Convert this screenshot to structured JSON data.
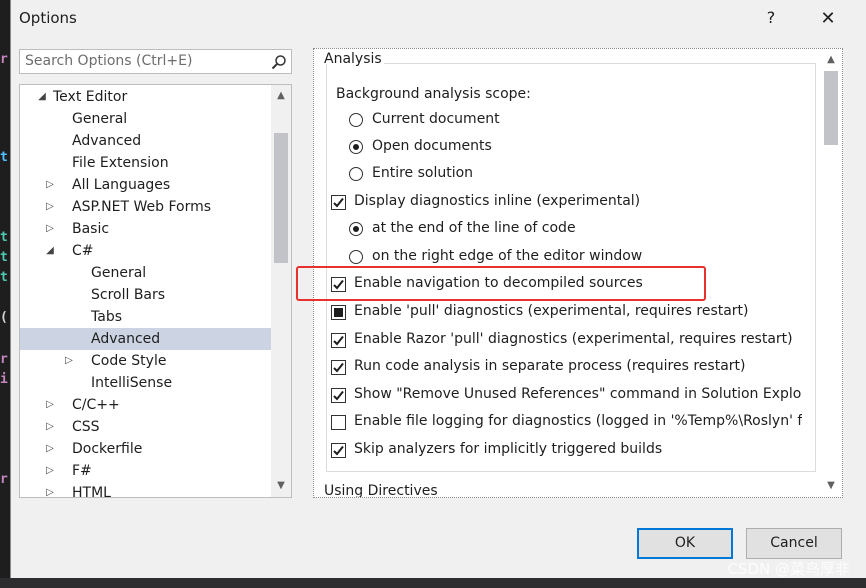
{
  "window": {
    "title": "Options",
    "help_label": "?",
    "close_label": "✕"
  },
  "search": {
    "placeholder": "Search Options (Ctrl+E)"
  },
  "tree": {
    "items": [
      {
        "label": "Text Editor",
        "arrow": "◢"
      },
      {
        "label": "General",
        "arrow": ""
      },
      {
        "label": "Advanced",
        "arrow": ""
      },
      {
        "label": "File Extension",
        "arrow": ""
      },
      {
        "label": "All Languages",
        "arrow": "▷"
      },
      {
        "label": "ASP.NET Web Forms",
        "arrow": "▷"
      },
      {
        "label": "Basic",
        "arrow": "▷"
      },
      {
        "label": "C#",
        "arrow": "◢"
      },
      {
        "label": "General",
        "arrow": ""
      },
      {
        "label": "Scroll Bars",
        "arrow": ""
      },
      {
        "label": "Tabs",
        "arrow": ""
      },
      {
        "label": "Advanced",
        "arrow": ""
      },
      {
        "label": "Code Style",
        "arrow": "▷"
      },
      {
        "label": "IntelliSense",
        "arrow": ""
      },
      {
        "label": "C/C++",
        "arrow": "▷"
      },
      {
        "label": "CSS",
        "arrow": "▷"
      },
      {
        "label": "Dockerfile",
        "arrow": "▷"
      },
      {
        "label": "F#",
        "arrow": "▷"
      },
      {
        "label": "HTML",
        "arrow": "▷"
      }
    ],
    "selected_label": "Advanced"
  },
  "analysis": {
    "group_title": "Analysis",
    "scope_label": "Background analysis scope:",
    "scope_options": [
      "Current document",
      "Open documents",
      "Entire solution"
    ],
    "scope_selected": "Open documents",
    "inline_label": "Display diagnostics inline (experimental)",
    "inline_options": [
      "at the end of the line of code",
      "on the right edge of the editor window"
    ],
    "inline_selected": "at the end of the line of code",
    "decompiled_label": "Enable navigation to decompiled sources",
    "pull_label": "Enable 'pull' diagnostics (experimental, requires restart)",
    "razor_label": "Enable Razor 'pull' diagnostics (experimental, requires restart)",
    "separate_label": "Run code analysis in separate process (requires restart)",
    "unused_label": "Show \"Remove Unused References\" command in Solution Explorer (",
    "logging_label": "Enable file logging for diagnostics (logged in '%Temp%\\Roslyn' folc",
    "skip_label": "Skip analyzers for implicitly triggered builds"
  },
  "next_group_title": "Using Directives",
  "buttons": {
    "ok": "OK",
    "cancel": "Cancel"
  },
  "watermark": "CSDN @菜鸟厚非",
  "colors": {
    "highlight": "#e8302c",
    "default_button_border": "#0078d7",
    "selected_row": "#ccd4e3"
  }
}
